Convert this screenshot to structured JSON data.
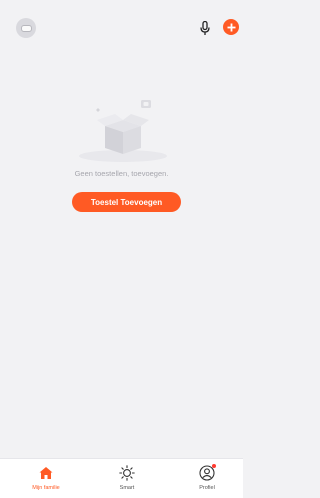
{
  "header": {
    "avatar_icon": "home-avatar-icon",
    "mic_icon": "microphone-icon",
    "add_icon": "plus-icon"
  },
  "empty_state": {
    "message": "Geen toestellen, toevoegen.",
    "button_label": "Toestel Toevoegen",
    "illustration": "empty-box-icon"
  },
  "tabs": [
    {
      "label": "Mijn familie",
      "icon": "home-icon",
      "active": true
    },
    {
      "label": "Smart",
      "icon": "sun-icon",
      "active": false
    },
    {
      "label": "Profiel",
      "icon": "profile-icon",
      "active": false,
      "badge": true
    }
  ],
  "colors": {
    "accent": "#ff5a24",
    "background": "#f2f2f4",
    "tabbar": "#ffffff",
    "muted_text": "#a6a6ad"
  }
}
